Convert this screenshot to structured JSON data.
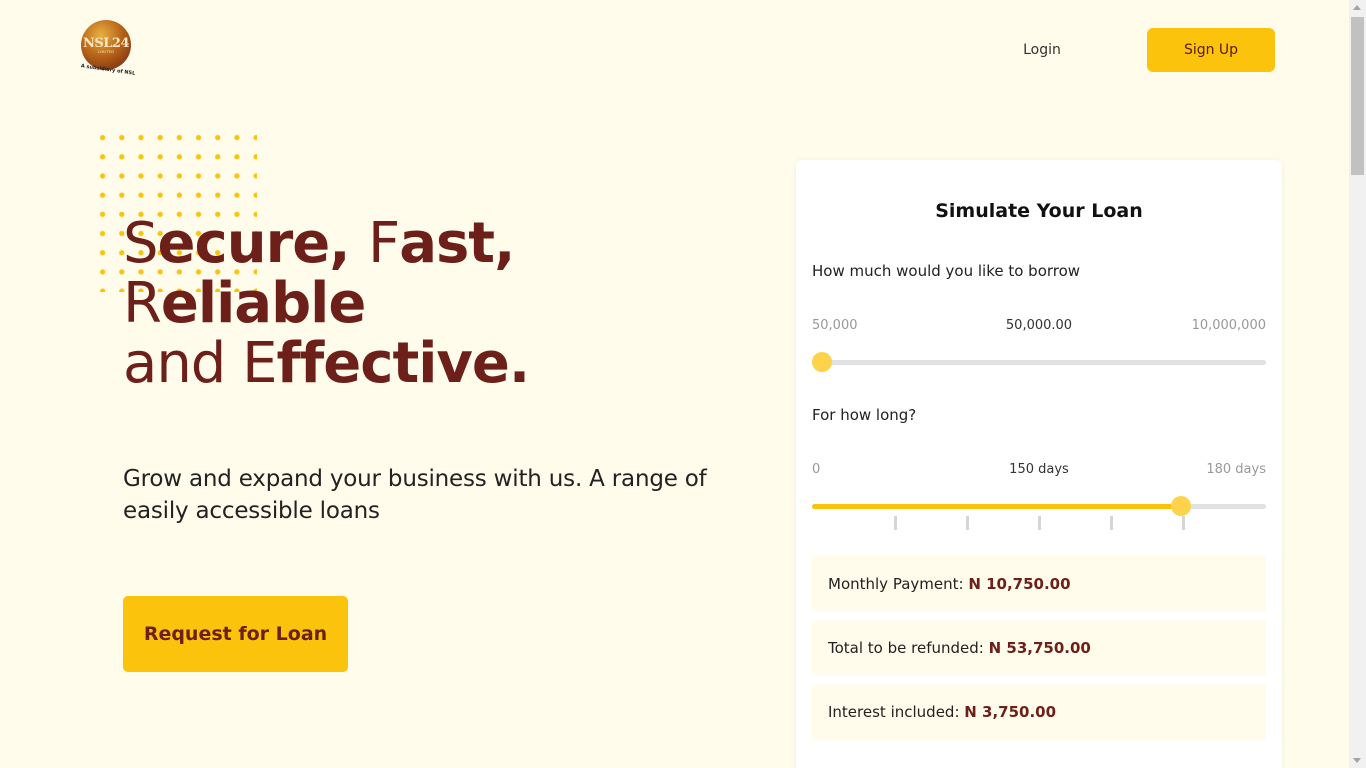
{
  "brand": {
    "logo_text": "NSL24",
    "logo_subtext": "LIMITED",
    "logo_caption": "A subsidiary of NSL"
  },
  "nav": {
    "login": "Login",
    "signup": "Sign Up"
  },
  "hero": {
    "line1_a": "S",
    "line1_b": "ecure, ",
    "line1_c": "F",
    "line1_d": "ast,",
    "line2_a": "R",
    "line2_b": "eliable",
    "line3_a": "and E",
    "line3_b": "ffective.",
    "subtitle": "Grow and expand your business with us. A range of easily accessible loans",
    "cta": "Request for Loan"
  },
  "simulator": {
    "title": "Simulate Your Loan",
    "amount": {
      "label": "How much would you like to borrow",
      "min": "50,000",
      "value": "50,000.00",
      "max": "10,000,000",
      "fraction": 0.0
    },
    "duration": {
      "label": "For how long?",
      "min": "0",
      "value": "150 days",
      "max": "180 days",
      "fraction": 0.8333
    },
    "results": [
      {
        "label": "Monthly Payment: ",
        "value": "N 10,750.00"
      },
      {
        "label": "Total to be refunded: ",
        "value": "N 53,750.00"
      },
      {
        "label": "Interest included: ",
        "value": "N 3,750.00"
      }
    ]
  },
  "colors": {
    "background": "#fffceb",
    "accent": "#fbc30b",
    "brand_dark": "#6d1f1a"
  }
}
